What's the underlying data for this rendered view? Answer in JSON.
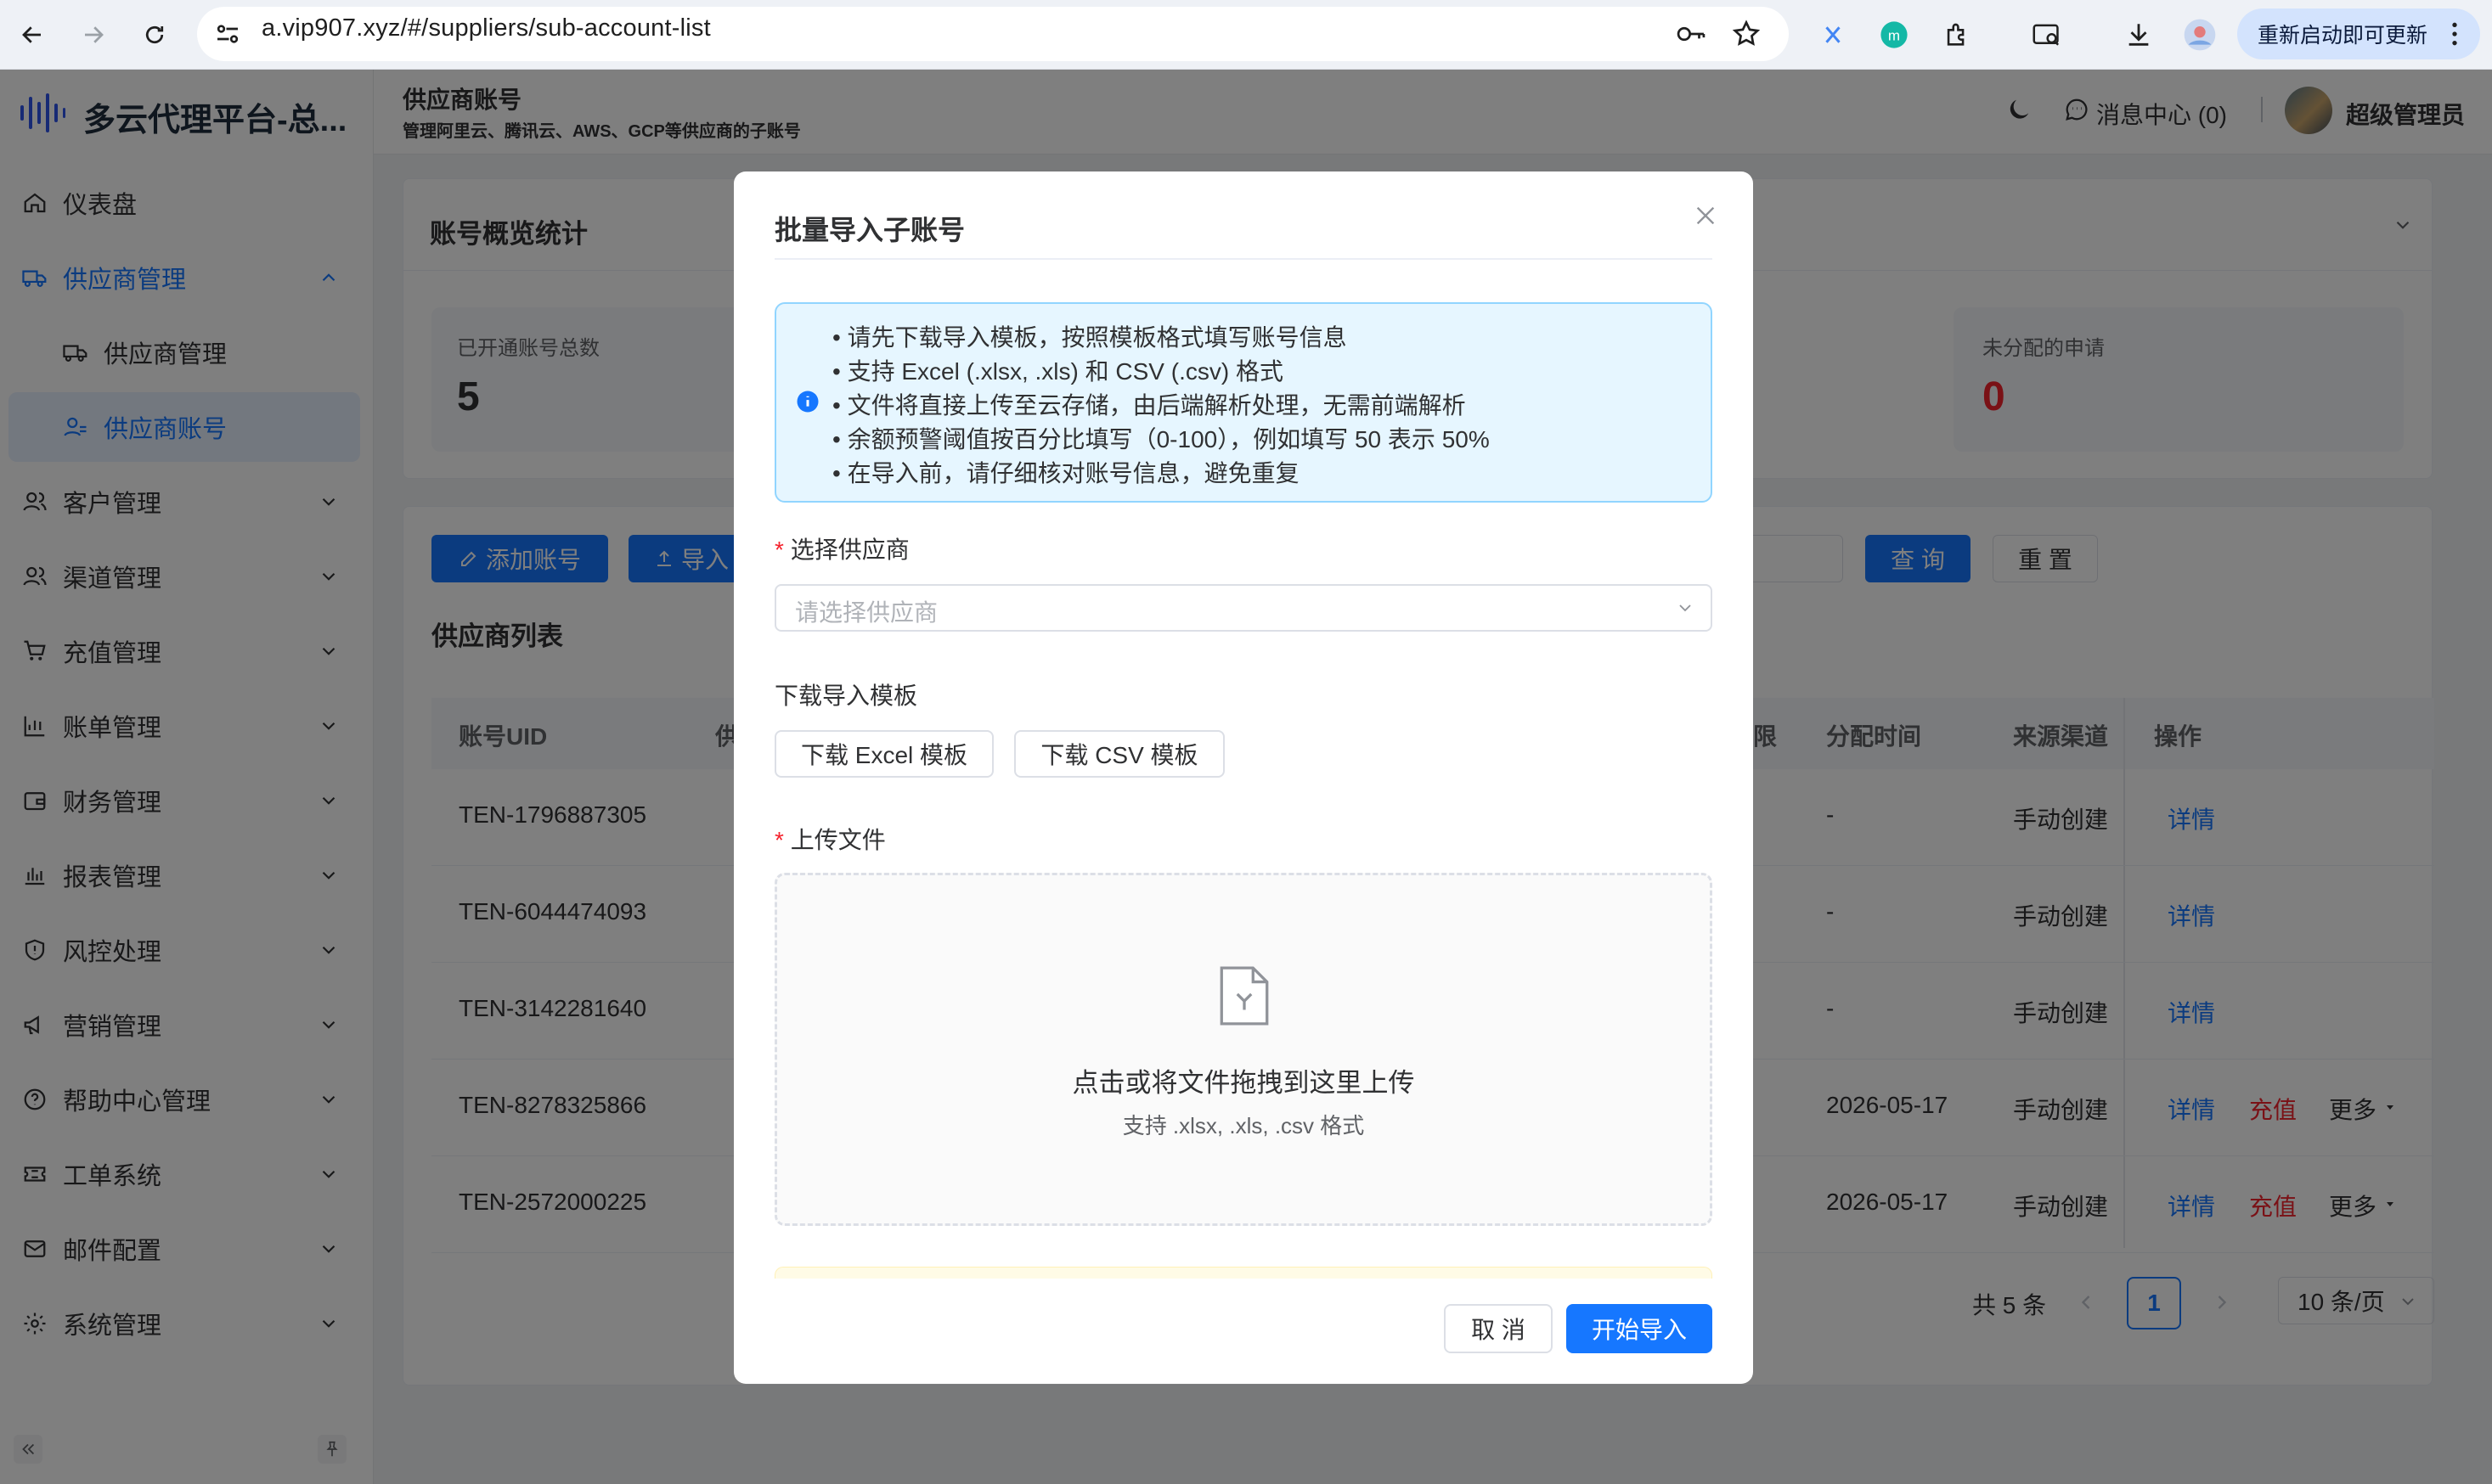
{
  "browser": {
    "url": "a.vip907.xyz/#/suppliers/sub-account-list",
    "update_button": "重新启动即可更新"
  },
  "sidebar": {
    "logo_text": "多云代理平台-总...",
    "items": [
      {
        "label": "仪表盘",
        "icon": "home-icon"
      },
      {
        "label": "供应商管理",
        "icon": "truck-icon"
      },
      {
        "label": "供应商管理",
        "icon": "truck-icon"
      },
      {
        "label": "供应商账号",
        "icon": "user-group-icon"
      },
      {
        "label": "客户管理",
        "icon": "users-icon"
      },
      {
        "label": "渠道管理",
        "icon": "users-icon"
      },
      {
        "label": "充值管理",
        "icon": "cart-icon"
      },
      {
        "label": "账单管理",
        "icon": "bar-chart-icon"
      },
      {
        "label": "财务管理",
        "icon": "wallet-icon"
      },
      {
        "label": "报表管理",
        "icon": "histogram-icon"
      },
      {
        "label": "风控处理",
        "icon": "shield-icon"
      },
      {
        "label": "营销管理",
        "icon": "megaphone-icon"
      },
      {
        "label": "帮助中心管理",
        "icon": "help-icon"
      },
      {
        "label": "工单系统",
        "icon": "ticket-icon"
      },
      {
        "label": "邮件配置",
        "icon": "mail-icon"
      },
      {
        "label": "系统管理",
        "icon": "gear-icon"
      }
    ]
  },
  "header": {
    "title": "供应商账号",
    "subtitle": "管理阿里云、腾讯云、AWS、GCP等供应商的子账号",
    "messages": "消息中心 (0)",
    "user": "超级管理员"
  },
  "stats": {
    "title": "账号概览统计",
    "total_label": "已开通账号总数",
    "total_value": "5",
    "unassigned_label": "未分配的申请",
    "unassigned_value": "0"
  },
  "list": {
    "add_button": "添加账号",
    "import_button": "导入",
    "query_button": "查 询",
    "reset_button": "重 置",
    "title": "供应商列表",
    "columns": {
      "uid": "账号UID",
      "supplier": "供",
      "limit": "限",
      "assign_time": "分配时间",
      "source": "来源渠道",
      "action": "操作"
    },
    "rows": [
      {
        "uid": "TEN-1796887305",
        "time": "-",
        "source": "手动创建",
        "detail": "详情",
        "recharge": "",
        "more": ""
      },
      {
        "uid": "TEN-6044474093",
        "time": "-",
        "source": "手动创建",
        "detail": "详情",
        "recharge": "",
        "more": ""
      },
      {
        "uid": "TEN-3142281640",
        "time": "-",
        "source": "手动创建",
        "detail": "详情",
        "recharge": "",
        "more": ""
      },
      {
        "uid": "TEN-8278325866",
        "time": "2026-05-17",
        "source": "手动创建",
        "detail": "详情",
        "recharge": "充值",
        "more": "更多"
      },
      {
        "uid": "TEN-2572000225",
        "time": "2026-05-17",
        "source": "手动创建",
        "detail": "详情",
        "recharge": "充值",
        "more": "更多"
      }
    ],
    "pagination": {
      "total": "共 5 条",
      "current": "1",
      "page_size": "10 条/页"
    }
  },
  "dialog": {
    "title": "批量导入子账号",
    "tips": [
      "请先下载导入模板，按照模板格式填写账号信息",
      "支持 Excel (.xlsx, .xls) 和 CSV (.csv) 格式",
      "文件将直接上传至云存储，由后端解析处理，无需前端解析",
      "余额预警阈值按百分比填写（0-100），例如填写 50 表示 50%",
      "在导入前，请仔细核对账号信息，避免重复"
    ],
    "supplier_label": "选择供应商",
    "supplier_placeholder": "请选择供应商",
    "template_label": "下载导入模板",
    "excel_button": "下载 Excel 模板",
    "csv_button": "下载 CSV 模板",
    "upload_label": "上传文件",
    "upload_text": "点击或将文件拖拽到这里上传",
    "upload_hint": "支持 .xlsx, .xls, .csv 格式",
    "cancel_button": "取 消",
    "confirm_button": "开始导入"
  },
  "colors": {
    "primary": "#1677ff",
    "danger": "#f5222d",
    "active_bg": "#e6f0ff",
    "tip_bg": "#e6f6ff"
  }
}
